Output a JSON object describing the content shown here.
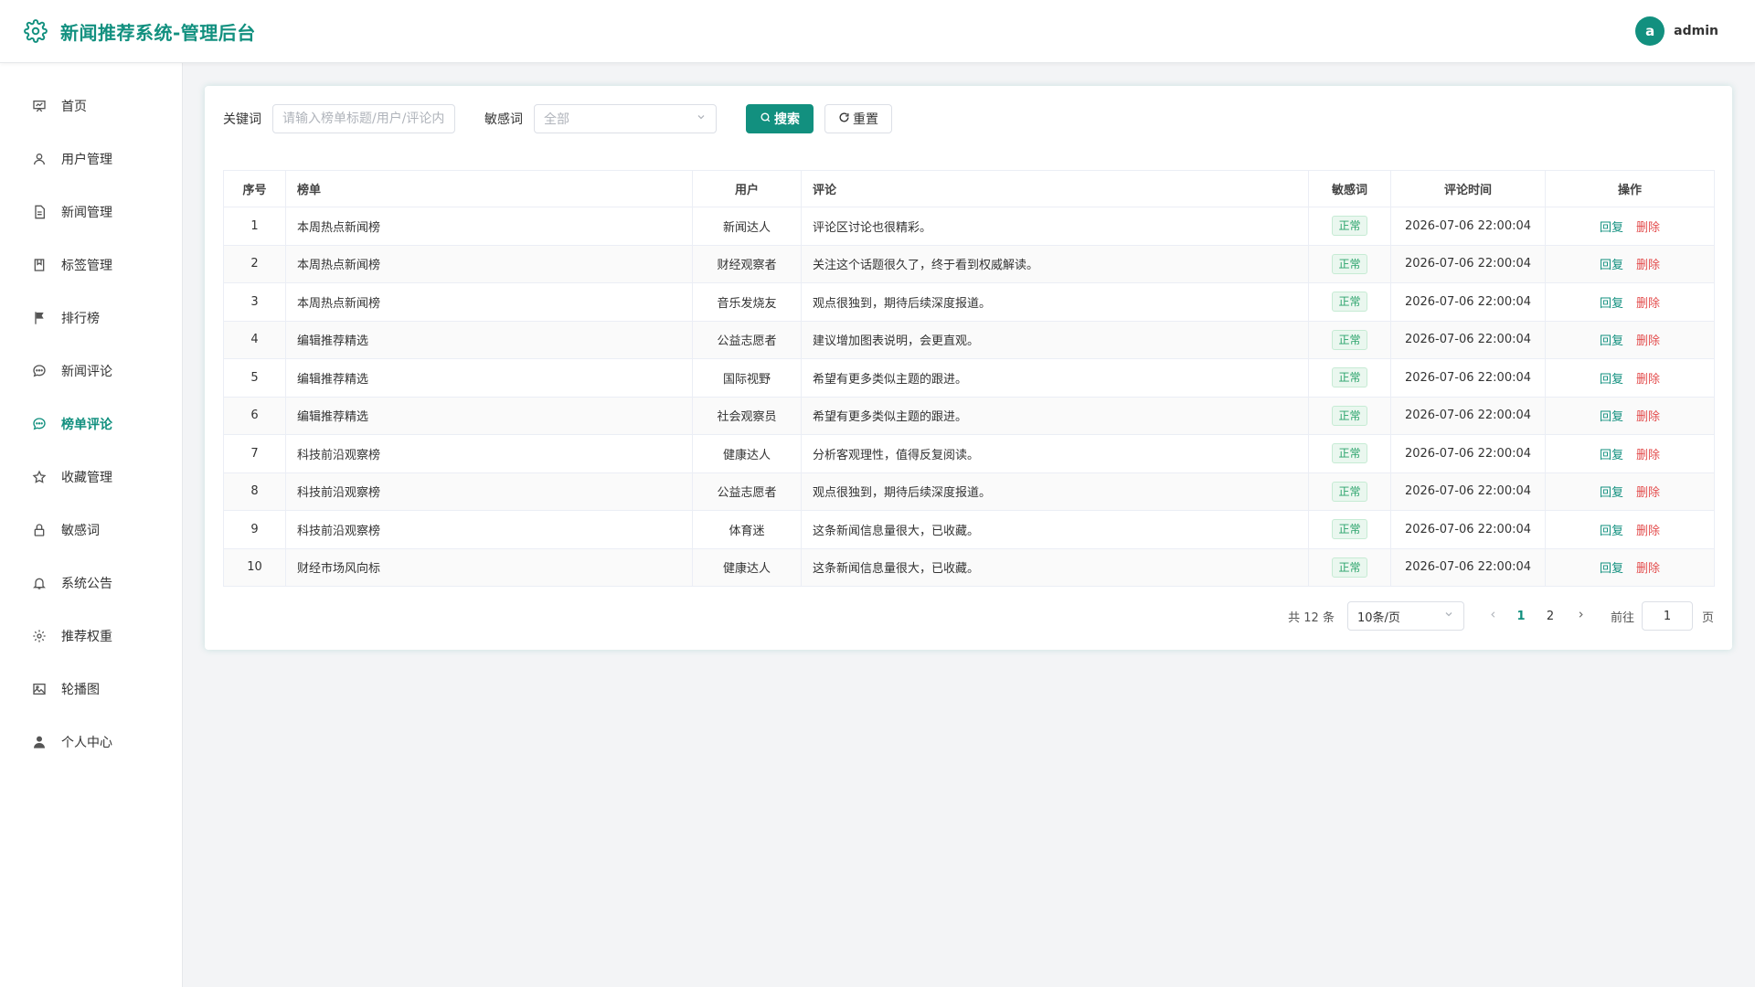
{
  "header": {
    "title": "新闻推荐系统-管理后台",
    "avatar_letter": "a",
    "username": "admin"
  },
  "sidebar": {
    "items": [
      {
        "label": "首页",
        "icon": "dashboard-icon"
      },
      {
        "label": "用户管理",
        "icon": "user-icon"
      },
      {
        "label": "新闻管理",
        "icon": "document-icon"
      },
      {
        "label": "标签管理",
        "icon": "tag-icon"
      },
      {
        "label": "排行榜",
        "icon": "flag-icon"
      },
      {
        "label": "新闻评论",
        "icon": "comment-icon"
      },
      {
        "label": "榜单评论",
        "icon": "comment-icon",
        "active": true
      },
      {
        "label": "收藏管理",
        "icon": "star-icon"
      },
      {
        "label": "敏感词",
        "icon": "lock-icon"
      },
      {
        "label": "系统公告",
        "icon": "bell-icon"
      },
      {
        "label": "推荐权重",
        "icon": "gear-icon"
      },
      {
        "label": "轮播图",
        "icon": "image-icon"
      },
      {
        "label": "个人中心",
        "icon": "person-icon"
      }
    ]
  },
  "filters": {
    "keyword_label": "关键词",
    "keyword_placeholder": "请输入榜单标题/用户/评论内容",
    "sensitive_label": "敏感词",
    "sensitive_value": "全部",
    "search_label": "搜索",
    "reset_label": "重置"
  },
  "table": {
    "columns": [
      "序号",
      "榜单",
      "用户",
      "评论",
      "敏感词",
      "评论时间",
      "操作"
    ],
    "rows": [
      {
        "index": "1",
        "board": "本周热点新闻榜",
        "user": "新闻达人",
        "comment": "评论区讨论也很精彩。",
        "status": "正常",
        "time": "2026-07-06 22:00:04"
      },
      {
        "index": "2",
        "board": "本周热点新闻榜",
        "user": "财经观察者",
        "comment": "关注这个话题很久了，终于看到权威解读。",
        "status": "正常",
        "time": "2026-07-06 22:00:04"
      },
      {
        "index": "3",
        "board": "本周热点新闻榜",
        "user": "音乐发烧友",
        "comment": "观点很独到，期待后续深度报道。",
        "status": "正常",
        "time": "2026-07-06 22:00:04"
      },
      {
        "index": "4",
        "board": "编辑推荐精选",
        "user": "公益志愿者",
        "comment": "建议增加图表说明，会更直观。",
        "status": "正常",
        "time": "2026-07-06 22:00:04"
      },
      {
        "index": "5",
        "board": "编辑推荐精选",
        "user": "国际视野",
        "comment": "希望有更多类似主题的跟进。",
        "status": "正常",
        "time": "2026-07-06 22:00:04"
      },
      {
        "index": "6",
        "board": "编辑推荐精选",
        "user": "社会观察员",
        "comment": "希望有更多类似主题的跟进。",
        "status": "正常",
        "time": "2026-07-06 22:00:04"
      },
      {
        "index": "7",
        "board": "科技前沿观察榜",
        "user": "健康达人",
        "comment": "分析客观理性，值得反复阅读。",
        "status": "正常",
        "time": "2026-07-06 22:00:04"
      },
      {
        "index": "8",
        "board": "科技前沿观察榜",
        "user": "公益志愿者",
        "comment": "观点很独到，期待后续深度报道。",
        "status": "正常",
        "time": "2026-07-06 22:00:04"
      },
      {
        "index": "9",
        "board": "科技前沿观察榜",
        "user": "体育迷",
        "comment": "这条新闻信息量很大，已收藏。",
        "status": "正常",
        "time": "2026-07-06 22:00:04"
      },
      {
        "index": "10",
        "board": "财经市场风向标",
        "user": "健康达人",
        "comment": "这条新闻信息量很大，已收藏。",
        "status": "正常",
        "time": "2026-07-06 22:00:04"
      }
    ],
    "actions": {
      "reply": "回复",
      "delete": "删除"
    }
  },
  "pagination": {
    "total_text": "共 12 条",
    "page_size": "10条/页",
    "pages": [
      "1",
      "2"
    ],
    "current_page": "1",
    "goto_label": "前往",
    "goto_value": "1",
    "goto_suffix": "页"
  },
  "colors": {
    "accent": "#12907f",
    "danger": "#e34d4d",
    "success": "#2aa36b"
  }
}
